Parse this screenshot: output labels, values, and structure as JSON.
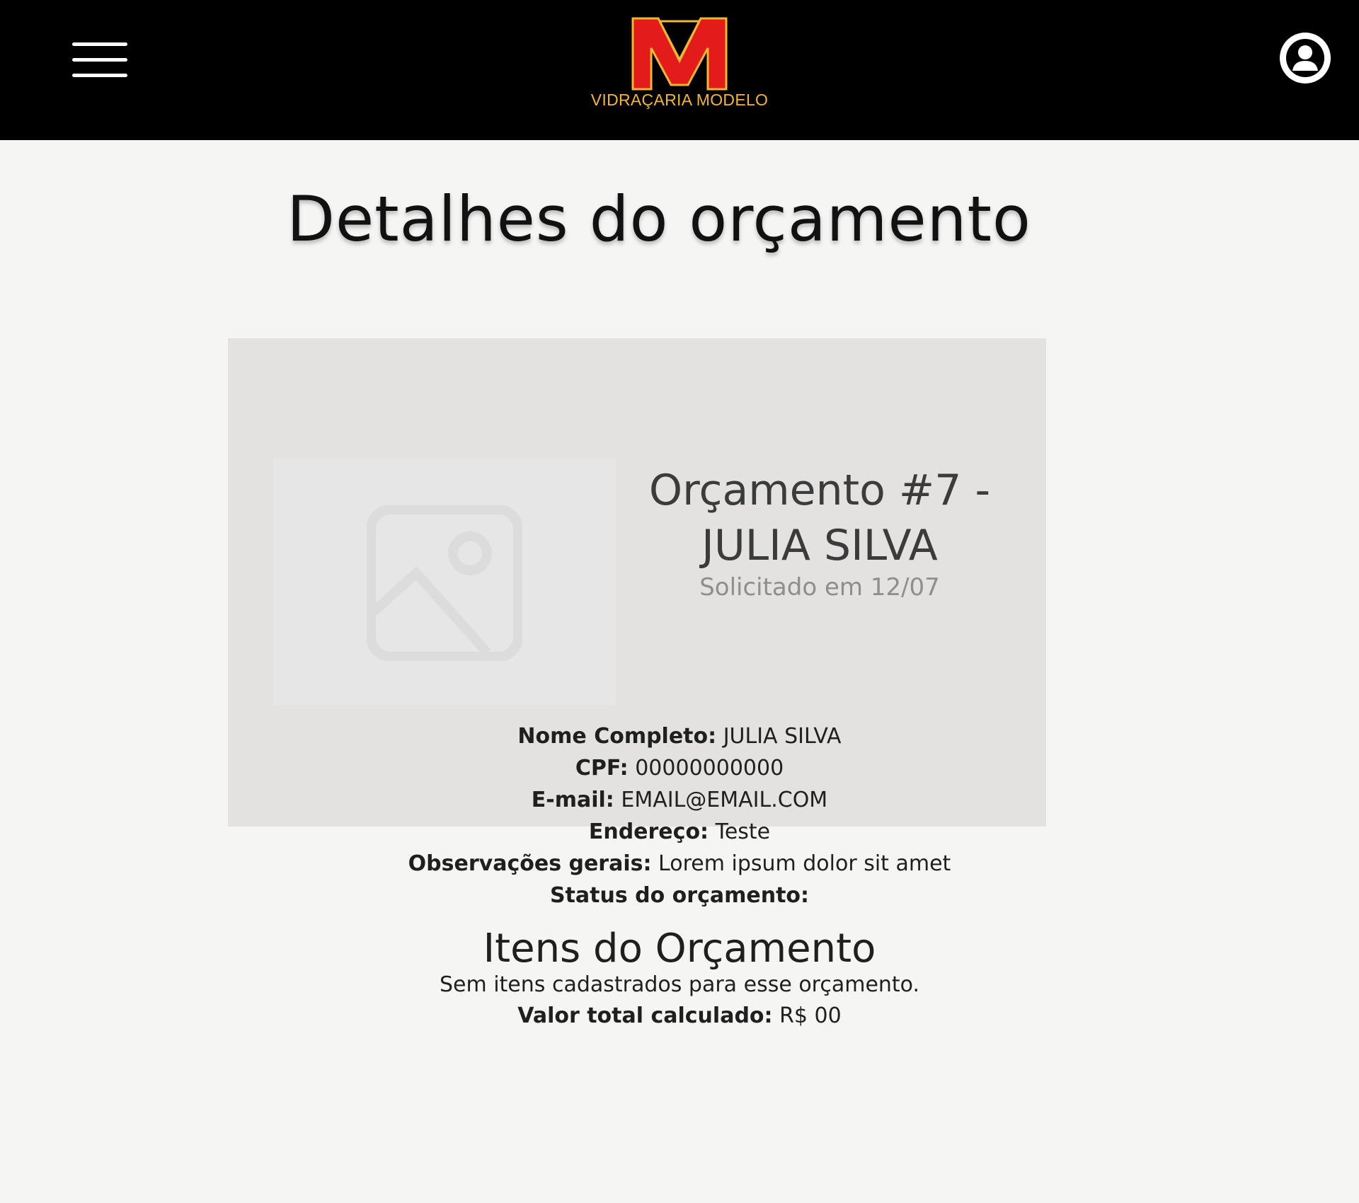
{
  "header": {
    "menu_icon": "hamburger-menu-icon",
    "logo_text": "VIDRAÇARIA MODELO",
    "logo_colors": {
      "red": "#e31b1b",
      "yellow": "#f2b632"
    },
    "user_icon": "user-avatar-icon"
  },
  "page": {
    "title": "Detalhes do orçamento"
  },
  "card": {
    "image_icon": "image-placeholder-icon",
    "heading_line1": "Orçamento #7 -",
    "heading_line2": "JULIA SILVA",
    "subtitle": "Solicitado em 12/07"
  },
  "details": {
    "name_label": "Nome Completo:",
    "name_value": "JULIA SILVA",
    "cpf_label": "CPF:",
    "cpf_value": "00000000000",
    "email_label": "E-mail:",
    "email_value": "EMAIL@EMAIL.COM",
    "address_label": "Endereço:",
    "address_value": "Teste",
    "notes_label": "Observações gerais:",
    "notes_value": "Lorem ipsum dolor sit amet",
    "status_label": "Status do orçamento:",
    "status_value": ""
  },
  "items": {
    "title": "Itens do Orçamento",
    "empty_message": "Sem itens cadastrados para esse orçamento.",
    "total_label": "Valor total calculado:",
    "total_value": "R$ 00"
  }
}
